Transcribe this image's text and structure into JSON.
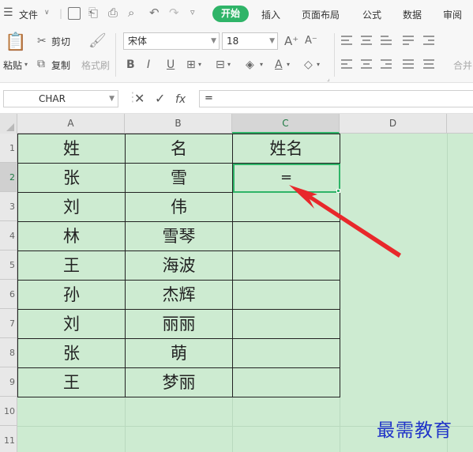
{
  "menu": {
    "file_label": "文件",
    "tabs": [
      "开始",
      "插入",
      "页面布局",
      "公式",
      "数据",
      "审阅"
    ]
  },
  "ribbon": {
    "paste_label": "粘贴",
    "cut_label": "剪切",
    "copy_label": "复制",
    "format_painter_label": "格式刷",
    "font_name": "宋体",
    "font_size": "18",
    "merge_label": "合并"
  },
  "formula_bar": {
    "name_box": "CHAR",
    "fx_label": "fx",
    "formula": "="
  },
  "sheet": {
    "columns": [
      "A",
      "B",
      "C",
      "D"
    ],
    "active_column": "C",
    "row_numbers": [
      "1",
      "2",
      "3",
      "4",
      "5",
      "6",
      "7",
      "8",
      "9",
      "10",
      "11"
    ],
    "active_row": "2",
    "rows": [
      [
        "姓",
        "名",
        "姓名"
      ],
      [
        "张",
        "雪",
        "="
      ],
      [
        "刘",
        "伟",
        ""
      ],
      [
        "林",
        "雪琴",
        ""
      ],
      [
        "王",
        "海波",
        ""
      ],
      [
        "孙",
        "杰辉",
        ""
      ],
      [
        "刘",
        "丽丽",
        ""
      ],
      [
        "张",
        "萌",
        ""
      ],
      [
        "王",
        "梦丽",
        ""
      ]
    ],
    "background_color": "#cdebd1",
    "accent_color": "#2fb468"
  },
  "annotation": {
    "arrow_color": "#e8282b"
  },
  "watermark": "最需教育"
}
